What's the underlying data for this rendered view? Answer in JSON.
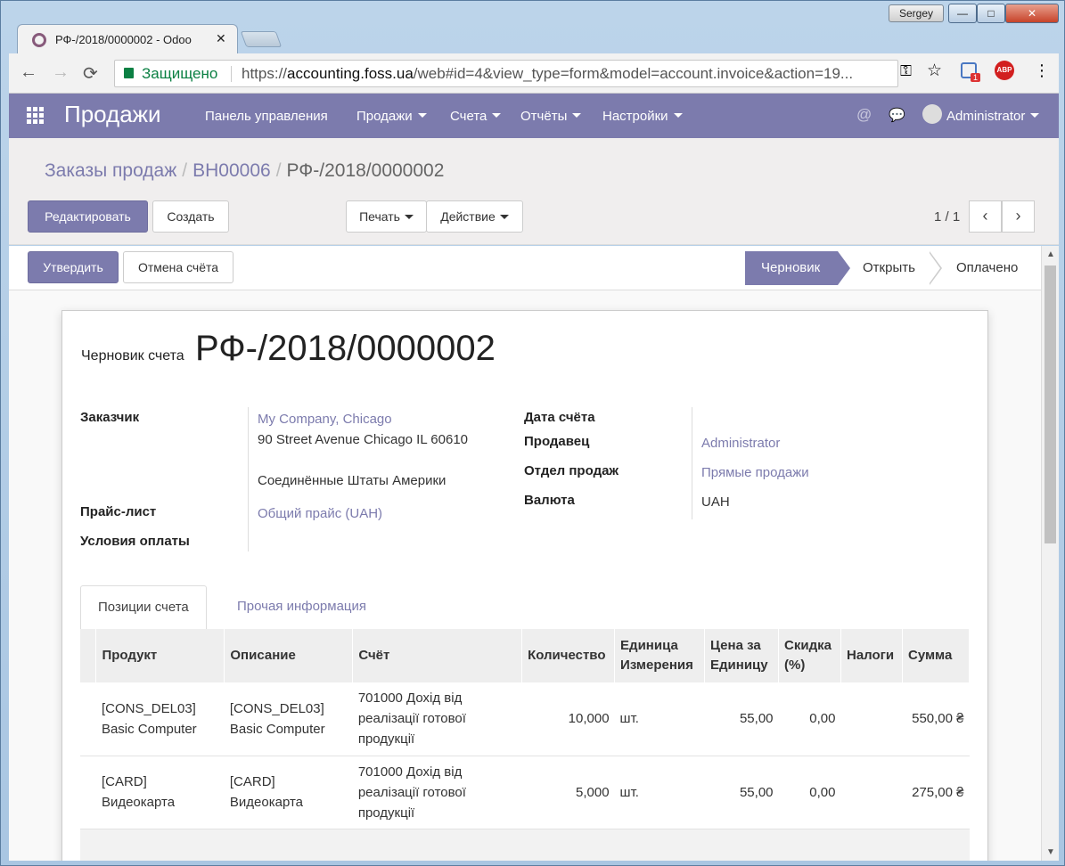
{
  "window": {
    "user": "Sergey",
    "min": "—",
    "max": "□",
    "close": "✕"
  },
  "browser": {
    "tab_title": "РФ-/2018/0000002 - Odoo",
    "tab_close": "✕",
    "back": "←",
    "forward": "→",
    "reload": "⟳",
    "secure_label": "Защищено",
    "url_scheme": "https://",
    "url_host": "accounting.foss.ua",
    "url_rest": "/web#id=4&view_type=form&model=account.invoice&action=19...",
    "key_icon": "⚿",
    "star_icon": "☆",
    "ext_badge": "1",
    "abp": "ABP",
    "more": "⋮"
  },
  "topnav": {
    "app": "Продажи",
    "menu": [
      "Панель управления",
      "Продажи",
      "Счета",
      "Отчёты",
      "Настройки"
    ],
    "at_icon": "@",
    "chat_icon": "💬",
    "user": "Administrator"
  },
  "breadcrumb": {
    "level1": "Заказы продаж",
    "level2": "ВН00006",
    "current": "РФ-/2018/0000002",
    "sep": "/"
  },
  "buttons": {
    "edit": "Редактировать",
    "create": "Создать",
    "print": "Печать",
    "action": "Действие",
    "validate": "Утвердить",
    "cancel": "Отмена счёта"
  },
  "pager": {
    "value": "1 / 1",
    "prev": "‹",
    "next": "›"
  },
  "status": [
    "Черновик",
    "Открыть",
    "Оплачено"
  ],
  "invoice": {
    "title_prefix": "Черновик счета",
    "number": "РФ-/2018/0000002",
    "customer_label": "Заказчик",
    "customer_name": "My Company, Chicago",
    "customer_addr1": "90 Street Avenue Chicago IL 60610",
    "customer_country": "Соединённые Штаты Америки",
    "pricelist_label": "Прайс-лист",
    "pricelist": "Общий прайс (UAH)",
    "terms_label": "Условия оплаты",
    "date_label": "Дата счёта",
    "salesperson_label": "Продавец",
    "salesperson": "Administrator",
    "team_label": "Отдел продаж",
    "team": "Прямые продажи",
    "currency_label": "Валюта",
    "currency": "UAH"
  },
  "form_tabs": [
    "Позиции счета",
    "Прочая информация"
  ],
  "lines": {
    "headers": {
      "product": "Продукт",
      "description": "Описание",
      "account": "Счёт",
      "quantity": "Количество",
      "uom_1": "Единица",
      "uom_2": "Измерения",
      "price_1": "Цена за",
      "price_2": "Единицу",
      "discount_1": "Скидка",
      "discount_2": "(%)",
      "taxes": "Налоги",
      "subtotal": "Сумма"
    },
    "rows": [
      {
        "product_1": "[CONS_DEL03]",
        "product_2": "Basic Computer",
        "desc_1": "[CONS_DEL03]",
        "desc_2": "Basic Computer",
        "acc_1": "701000 Дохід від",
        "acc_2": "реалізації готової",
        "acc_3": "продукції",
        "qty": "10,000",
        "uom": "шт.",
        "price": "55,00",
        "discount": "0,00",
        "taxes": "",
        "subtotal": "550,00 ₴"
      },
      {
        "product_1": "[CARD]",
        "product_2": "Видеокарта",
        "desc_1": "[CARD]",
        "desc_2": "Видеокарта",
        "acc_1": "701000 Дохід від",
        "acc_2": "реалізації готової",
        "acc_3": "продукції",
        "qty": "5,000",
        "uom": "шт.",
        "price": "55,00",
        "discount": "0,00",
        "taxes": "",
        "subtotal": "275,00 ₴"
      }
    ]
  },
  "colors": {
    "brand": "#7c7bad",
    "link": "#7c7bad",
    "secure": "#0b8043"
  }
}
